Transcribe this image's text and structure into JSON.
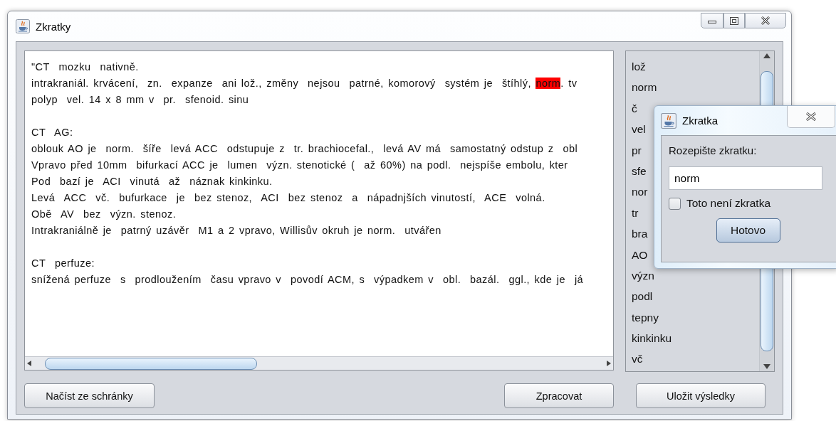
{
  "window": {
    "title": "Zkratky"
  },
  "editor": {
    "lines": [
      {
        "kind": "text",
        "segments": [
          {
            "text": "\"CT  mozku  nativně."
          }
        ]
      },
      {
        "kind": "text",
        "segments": [
          {
            "text": "intrakraniál. krvácení,  zn.  expanze  ani lož., změny  nejsou  patrné, komorový  systém je  štíhlý, "
          },
          {
            "text": "norm",
            "highlight": true
          },
          {
            "text": ". tv"
          }
        ]
      },
      {
        "kind": "text",
        "segments": [
          {
            "text": "polyp  vel. 14 x 8 mm v  pr.  sfenoid. sinu"
          }
        ]
      },
      {
        "kind": "blank"
      },
      {
        "kind": "text",
        "segments": [
          {
            "text": "CT  AG:"
          }
        ]
      },
      {
        "kind": "text",
        "segments": [
          {
            "text": "oblouk AO je  norm.  šíře  levá ACC  odstupuje z  tr. brachiocefal.,  levá AV má  samostatný odstup z  obl"
          }
        ]
      },
      {
        "kind": "text",
        "segments": [
          {
            "text": "Vpravo před 10mm  bifurkací ACC je  lumen  význ. stenotické (  až 60%) na podl.  nejspíše embolu, kter"
          }
        ]
      },
      {
        "kind": "text",
        "segments": [
          {
            "text": "Pod  bazí je  ACI  vinutá  až  náznak kinkinku."
          }
        ]
      },
      {
        "kind": "text",
        "segments": [
          {
            "text": "Levá  ACC  vč.  bufurkace  je  bez stenoz,  ACI  bez stenoz  a  nápadnjších vinutostí,  ACE  volná."
          }
        ]
      },
      {
        "kind": "text",
        "segments": [
          {
            "text": "Obě  AV  bez  význ. stenoz."
          }
        ]
      },
      {
        "kind": "text",
        "segments": [
          {
            "text": "Intrakraniálně je  patrný uzávěr  M1 a 2 vpravo, Willisův okruh je norm.  utvářen"
          }
        ]
      },
      {
        "kind": "blank"
      },
      {
        "kind": "text",
        "segments": [
          {
            "text": "CT  perfuze:"
          }
        ]
      },
      {
        "kind": "text",
        "segments": [
          {
            "text": "snížená perfuze  s  prodloužením  času vpravo v  povodí ACM, s  výpadkem v  obl.  bazál.  ggl., kde je  já"
          }
        ]
      }
    ]
  },
  "abbreviations": [
    "lož",
    "norm",
    "č",
    "vel",
    "pr",
    "sfe",
    "nor",
    "tr",
    "bra",
    "AO",
    "význ",
    "podl",
    "tepny",
    "kinkinku",
    "vč"
  ],
  "buttons": [
    {
      "label": "Načíst ze schránky",
      "kind": "load"
    },
    {
      "label": "Zpracovat",
      "kind": "process"
    },
    {
      "label": "Uložit výsledky",
      "kind": "save"
    }
  ],
  "dialog": {
    "title": "Zkratka",
    "prompt": "Rozepište zkratku:",
    "value": "norm",
    "checkbox": {
      "label": "Toto není zkratka",
      "checked": false
    },
    "button": "Hotovo"
  }
}
